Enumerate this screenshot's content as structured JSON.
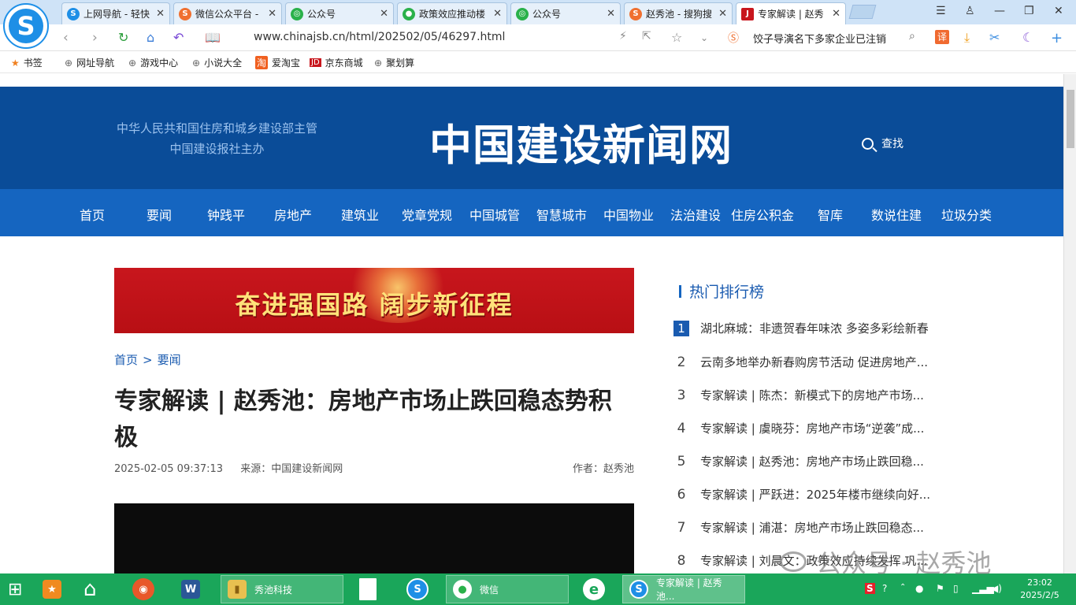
{
  "browser": {
    "tabs": [
      {
        "title": "上网导航 - 轻快",
        "icon": "sogou-s-icon",
        "color": "#1e8fe6"
      },
      {
        "title": "微信公众平台 -",
        "icon": "sogou-search-icon",
        "color": "#f07030"
      },
      {
        "title": "公众号",
        "icon": "wechat-green-icon",
        "color": "#2ab14a"
      },
      {
        "title": "政策效应推动楼",
        "icon": "wechat-icon",
        "color": "#2ab14a"
      },
      {
        "title": "公众号",
        "icon": "wechat-green-icon",
        "color": "#2ab14a"
      },
      {
        "title": "赵秀池 - 搜狗搜",
        "icon": "sogou-search-icon",
        "color": "#f07030"
      },
      {
        "title": "专家解读 | 赵秀",
        "icon": "site-favicon-icon",
        "color": "#c8161d"
      }
    ],
    "url": "www.chinajsb.cn/html/202502/05/46297.html",
    "search_suggestion": "饺子导演名下多家企业已注销",
    "bookmarks": [
      "书签",
      "网址导航",
      "游戏中心",
      "小说大全",
      "爱淘宝",
      "京东商城",
      "聚划算"
    ]
  },
  "site": {
    "sub1": "中华人民共和国住房和城乡建设部主管",
    "sub2": "中国建设报社主办",
    "title": "中国建设新闻网",
    "search_label": "查找",
    "nav": [
      "首页",
      "要闻",
      "钟践平",
      "房地产",
      "建筑业",
      "党章党规",
      "中国城管",
      "智慧城市",
      "中国物业",
      "法治建设",
      "住房公积金",
      "智库",
      "数说住建",
      "垃圾分类"
    ],
    "banner_text": "奋进强国路  阔步新征程"
  },
  "article": {
    "crumb_home": "首页",
    "crumb_sep": ">",
    "crumb_section": "要闻",
    "title": "专家解读 | 赵秀池：房地产市场止跌回稳态势积极",
    "date": "2025-02-05 09:37:13",
    "source": "来源：中国建设新闻网",
    "author": "作者：赵秀池"
  },
  "hot": {
    "heading": "热门排行榜",
    "items": [
      {
        "n": "1",
        "t": "湖北麻城：非遗贺春年味浓 多姿多彩绘新春"
      },
      {
        "n": "2",
        "t": "云南多地举办新春购房节活动 促进房地产..."
      },
      {
        "n": "3",
        "t": "专家解读 | 陈杰：新模式下的房地产市场..."
      },
      {
        "n": "4",
        "t": "专家解读 | 虞晓芬：房地产市场“逆袭”成..."
      },
      {
        "n": "5",
        "t": "专家解读 | 赵秀池：房地产市场止跌回稳..."
      },
      {
        "n": "6",
        "t": "专家解读 | 严跃进：2025年楼市继续向好..."
      },
      {
        "n": "7",
        "t": "专家解读 | 浦湛：房地产市场止跌回稳态..."
      },
      {
        "n": "8",
        "t": "专家解读 | 刘晨文：政策效应持续发挥 巩..."
      }
    ]
  },
  "watermark": "公众号 · 赵秀池",
  "taskbar": {
    "apps": [
      "秀池科技",
      "微信",
      "专家解读 | 赵秀池..."
    ],
    "time": "23:02",
    "date": "2025/2/5"
  }
}
